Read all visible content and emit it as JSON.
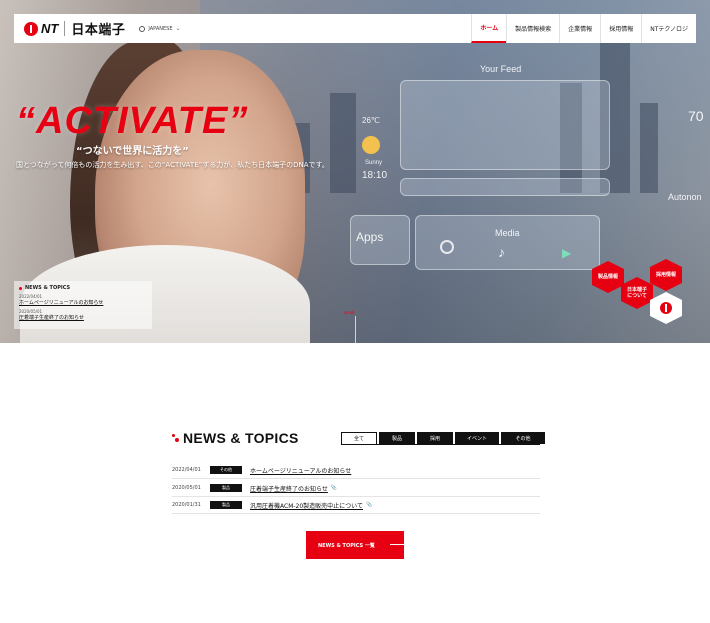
{
  "header": {
    "logo_nt": "NT",
    "logo_jp": "日本端子",
    "language": "JAPANESE",
    "nav": [
      {
        "label": "ホーム",
        "active": true
      },
      {
        "label": "製品情報検索",
        "active": false
      },
      {
        "label": "企業情報",
        "active": false
      },
      {
        "label": "採用情報",
        "active": false
      },
      {
        "label": "NTテクノロジ",
        "active": false
      }
    ]
  },
  "hero": {
    "slogan": "“ACTIVATE”",
    "tagline": "“つないで世界に活力を”",
    "subline": "国とつながって何倍もの活力を生み出す、この“ACTIVATE”する力が、私たち日本端子のDNAです。",
    "hud": {
      "feed": "Your Feed",
      "temp": "26℃",
      "weather": "Sunny",
      "time": "18:10",
      "apps": "Apps",
      "media": "Media",
      "autonomy": "Autonon",
      "speed": "70"
    },
    "scroll_label": "scroll",
    "mini_news": {
      "title": "NEWS & TOPICS",
      "items": [
        {
          "date": "2022/04/01",
          "title": "ホームページリニューアルのお知らせ"
        },
        {
          "date": "2020/05/01",
          "title": "圧着端子生産終了のお知らせ"
        }
      ]
    },
    "hexagons": [
      {
        "label": "製品情報"
      },
      {
        "label": "採用情報"
      },
      {
        "label": "日本端子について"
      }
    ]
  },
  "news": {
    "title": "NEWS & TOPICS",
    "tabs": [
      {
        "label": "全て",
        "active": true
      },
      {
        "label": "製品",
        "active": false
      },
      {
        "label": "採用",
        "active": false
      },
      {
        "label": "イベント",
        "active": false
      },
      {
        "label": "その他",
        "active": false
      }
    ],
    "items": [
      {
        "date": "2022/04/01",
        "category": "その他",
        "title": "ホームページリニューアルのお知らせ",
        "pdf": false
      },
      {
        "date": "2020/05/01",
        "category": "製品",
        "title": "圧着端子生産終了のお知らせ",
        "pdf": true
      },
      {
        "date": "2020/01/31",
        "category": "製品",
        "title": "汎用圧着機ACM-20製造販売中止について",
        "pdf": true
      }
    ],
    "more_label": "NEWS & TOPICS 一覧"
  },
  "colors": {
    "accent": "#e60012",
    "dark": "#111111"
  }
}
